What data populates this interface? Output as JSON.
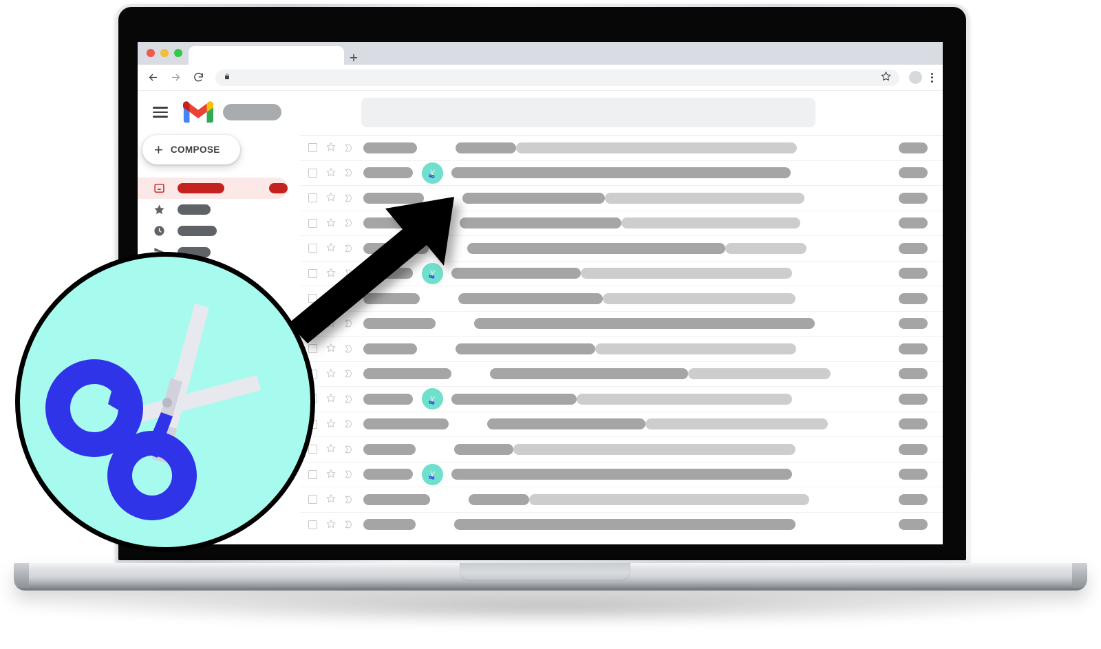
{
  "browser": {
    "traffic_lights": [
      {
        "name": "close",
        "color": "#f2594b"
      },
      {
        "name": "minimize",
        "color": "#f5bb3c"
      },
      {
        "name": "maximize",
        "color": "#34c84a"
      }
    ],
    "tab_title": "",
    "new_tab_label": "+",
    "back_icon": "arrow-left-icon",
    "forward_icon": "arrow-right-icon",
    "reload_icon": "reload-icon",
    "lock_icon": "lock-icon",
    "address_value": "",
    "address_placeholder": "",
    "bookmark_icon": "star-outline-icon",
    "profile_icon": "avatar-icon",
    "menu_icon": "kebab-menu-icon"
  },
  "gmail": {
    "menu_icon": "hamburger-icon",
    "logo_icon": "gmail-logo-icon",
    "wordmark_redacted": "",
    "search": {
      "value": "",
      "placeholder": ""
    },
    "compose": {
      "plus": "+",
      "label": "COMPOSE"
    },
    "sidebar": [
      {
        "icon": "inbox-icon",
        "label": "",
        "pill_width": 68,
        "active": true,
        "count": ""
      },
      {
        "icon": "star-icon",
        "label": "",
        "pill_width": 48,
        "active": false
      },
      {
        "icon": "clock-icon",
        "label": "",
        "pill_width": 57,
        "active": false
      },
      {
        "icon": "send-icon",
        "label": "",
        "pill_width": 48,
        "active": false
      }
    ],
    "row_icons": {
      "checkbox": "checkbox-icon",
      "star": "star-outline-icon",
      "important": "forward-marker-icon",
      "scissors": "scissors-badge-icon"
    },
    "rows": [
      {
        "sender_w": 78,
        "scissors": false,
        "subject_dark": 88,
        "subject_light": 408,
        "date_w": 42
      },
      {
        "sender_w": 72,
        "scissors": true,
        "subject_dark": 493,
        "subject_light": 0,
        "date_w": 42
      },
      {
        "sender_w": 88,
        "scissors": false,
        "subject_dark": 207,
        "subject_light": 290,
        "date_w": 42
      },
      {
        "sender_w": 84,
        "scissors": false,
        "subject_dark": 235,
        "subject_light": 260,
        "date_w": 42
      },
      {
        "sender_w": 95,
        "scissors": false,
        "subject_dark": 375,
        "subject_light": 118,
        "date_w": 42
      },
      {
        "sender_w": 72,
        "scissors": true,
        "subject_dark": 188,
        "subject_light": 307,
        "date_w": 42
      },
      {
        "sender_w": 82,
        "scissors": false,
        "subject_dark": 210,
        "subject_light": 280,
        "date_w": 42
      },
      {
        "sender_w": 105,
        "scissors": false,
        "subject_dark": 495,
        "subject_light": 0,
        "date_w": 42
      },
      {
        "sender_w": 78,
        "scissors": false,
        "subject_dark": 203,
        "subject_light": 292,
        "date_w": 42
      },
      {
        "sender_w": 128,
        "scissors": false,
        "subject_dark": 288,
        "subject_light": 207,
        "date_w": 42
      },
      {
        "sender_w": 72,
        "scissors": true,
        "subject_dark": 182,
        "subject_light": 313,
        "date_w": 42
      },
      {
        "sender_w": 124,
        "scissors": false,
        "subject_dark": 230,
        "subject_light": 265,
        "date_w": 42
      },
      {
        "sender_w": 76,
        "scissors": false,
        "subject_dark": 86,
        "subject_light": 410,
        "date_w": 42
      },
      {
        "sender_w": 72,
        "scissors": true,
        "subject_dark": 495,
        "subject_light": 0,
        "date_w": 42
      },
      {
        "sender_w": 97,
        "scissors": false,
        "subject_dark": 88,
        "subject_light": 407,
        "date_w": 42
      },
      {
        "sender_w": 76,
        "scissors": false,
        "subject_dark": 496,
        "subject_light": 0,
        "date_w": 42
      }
    ]
  },
  "callout": {
    "magnifier_icon": "scissors-icon-magnified",
    "arrow_icon": "pointer-arrow-icon",
    "circle_color": "#a6fbee",
    "scissors_handle_color": "#2f34e8",
    "scissors_blade_color": "#e6e6ee",
    "badge_color": "#6fe0cc"
  },
  "colors": {
    "gmail_red": "#c5221f",
    "gmail_red_bg": "#fce8e6",
    "mint": "#a6fbee",
    "blue": "#2f34e8",
    "pill_dark": "#a5a5a5",
    "pill_light": "#cdcdcd"
  }
}
